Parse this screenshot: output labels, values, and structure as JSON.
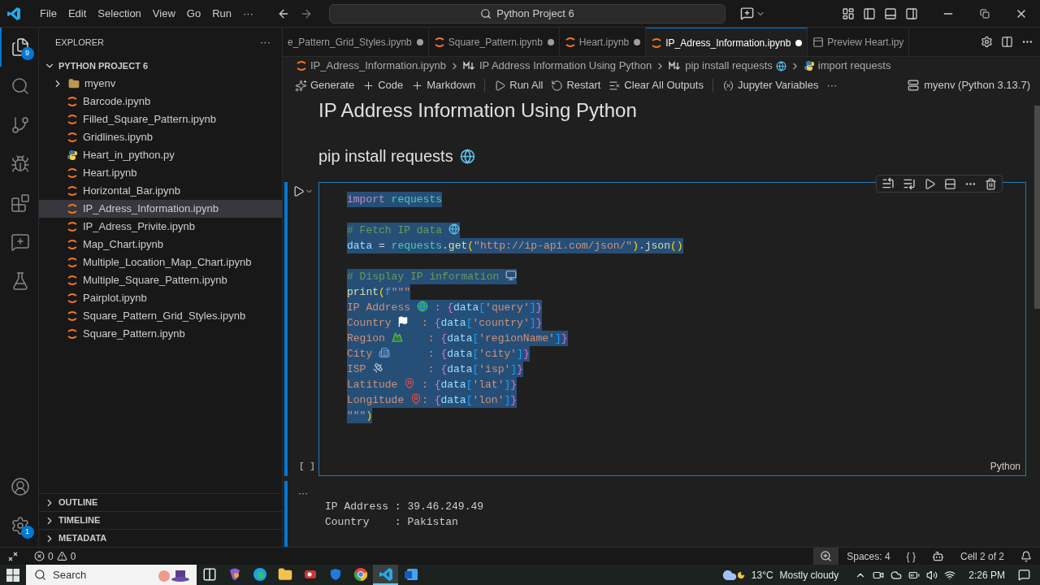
{
  "titlebar": {
    "menu": [
      "File",
      "Edit",
      "Selection",
      "View",
      "Go",
      "Run",
      "···"
    ],
    "search": "Python Project 6"
  },
  "activity_bar": {
    "top": [
      {
        "kind": "explorer",
        "selected": true,
        "badge": "9"
      },
      {
        "kind": "search",
        "selected": false
      },
      {
        "kind": "source-control",
        "selected": false
      },
      {
        "kind": "debug",
        "selected": false
      },
      {
        "kind": "extensions",
        "selected": false
      },
      {
        "kind": "chat",
        "selected": false
      },
      {
        "kind": "testing",
        "selected": false
      }
    ],
    "bottom": [
      {
        "kind": "account",
        "selected": false
      },
      {
        "kind": "settings",
        "selected": false,
        "badge": "1"
      }
    ]
  },
  "sidebar": {
    "title": "EXPLORER",
    "more": "···",
    "project": {
      "name": "PYTHON PROJECT 6",
      "expanded": true
    },
    "files": [
      {
        "name": "myenv",
        "kind": "folder",
        "expanded": false,
        "selected": false
      },
      {
        "name": "Barcode.ipynb",
        "kind": "notebook",
        "selected": false
      },
      {
        "name": "Filled_Square_Pattern.ipynb",
        "kind": "notebook",
        "selected": false
      },
      {
        "name": "Gridlines.ipynb",
        "kind": "notebook",
        "selected": false
      },
      {
        "name": "Heart_in_python.py",
        "kind": "python",
        "selected": false
      },
      {
        "name": "Heart.ipynb",
        "kind": "notebook",
        "selected": false
      },
      {
        "name": "Horizontal_Bar.ipynb",
        "kind": "notebook",
        "selected": false
      },
      {
        "name": "IP_Adress_Information.ipynb",
        "kind": "notebook",
        "selected": true
      },
      {
        "name": "IP_Adress_Privite.ipynb",
        "kind": "notebook",
        "selected": false
      },
      {
        "name": "Map_Chart.ipynb",
        "kind": "notebook",
        "selected": false
      },
      {
        "name": "Multiple_Location_Map_Chart.ipynb",
        "kind": "notebook",
        "selected": false
      },
      {
        "name": "Multiple_Square_Pattern.ipynb",
        "kind": "notebook",
        "selected": false
      },
      {
        "name": "Pairplot.ipynb",
        "kind": "notebook",
        "selected": false
      },
      {
        "name": "Square_Pattern_Grid_Styles.ipynb",
        "kind": "notebook",
        "selected": false
      },
      {
        "name": "Square_Pattern.ipynb",
        "kind": "notebook",
        "selected": false
      }
    ],
    "sections": [
      {
        "name": "OUTLINE",
        "expanded": false
      },
      {
        "name": "TIMELINE",
        "expanded": false
      },
      {
        "name": "METADATA",
        "expanded": false
      }
    ]
  },
  "tabs": [
    {
      "label": "e_Pattern_Grid_Styles.ipynb",
      "kind": "plain",
      "modified": true,
      "selected": false
    },
    {
      "label": "Square_Pattern.ipynb",
      "kind": "notebook",
      "modified": true,
      "selected": false
    },
    {
      "label": "Heart.ipynb",
      "kind": "notebook",
      "modified": true,
      "selected": false
    },
    {
      "label": "IP_Adress_Information.ipynb",
      "kind": "notebook",
      "modified": true,
      "selected": true
    },
    {
      "label": "Preview Heart.ipy",
      "kind": "preview",
      "modified": false,
      "selected": false
    }
  ],
  "breadcrumbs": [
    {
      "label": "IP_Adress_Information.ipynb",
      "kind": "notebook"
    },
    {
      "label": "IP Address Information Using Python",
      "kind": "markdown"
    },
    {
      "label": "pip install requests",
      "kind": "markdown-globe"
    },
    {
      "label": "import requests",
      "kind": "python"
    }
  ],
  "toolbar": [
    {
      "label": "Generate",
      "kind": "generate"
    },
    {
      "label": "Code",
      "kind": "add"
    },
    {
      "label": "Markdown",
      "kind": "add"
    },
    {
      "kind": "separator"
    },
    {
      "label": "Run All",
      "kind": "run"
    },
    {
      "label": "Restart",
      "kind": "restart"
    },
    {
      "label": "Clear All Outputs",
      "kind": "clear"
    },
    {
      "kind": "separator"
    },
    {
      "label": "Jupyter Variables",
      "kind": "variables"
    },
    {
      "label": "···",
      "kind": "more"
    }
  ],
  "kernel": "myenv (Python 3.13.7)",
  "notebook": {
    "heading": "IP Address Information Using Python",
    "subheading": "pip install requests",
    "cell": {
      "selected": true,
      "language": "Python",
      "execution": "[ ]",
      "lines": [
        {
          "blank_before": false,
          "tokens": [
            {
              "t": "import",
              "kind": "keyword"
            },
            {
              "t": " requests",
              "kind": "module"
            }
          ]
        },
        {
          "blank_before": true,
          "tokens": [
            {
              "t": "# Fetch IP data ",
              "kind": "comment"
            },
            {
              "kind": "globe"
            }
          ]
        },
        {
          "blank_before": false,
          "tokens": [
            {
              "t": "data",
              "kind": "variable"
            },
            {
              "t": " = ",
              "kind": "plain"
            },
            {
              "t": "requests",
              "kind": "module"
            },
            {
              "t": ".",
              "kind": "plain"
            },
            {
              "t": "get",
              "kind": "function"
            },
            {
              "t": "(",
              "kind": "paren"
            },
            {
              "t": "\"http://ip-api.com/json/\"",
              "kind": "string"
            },
            {
              "t": ")",
              "kind": "paren"
            },
            {
              "t": ".",
              "kind": "plain"
            },
            {
              "t": "json",
              "kind": "function"
            },
            {
              "t": "()",
              "kind": "paren"
            }
          ]
        },
        {
          "blank_before": true,
          "tokens": [
            {
              "t": "# Display IP information ",
              "kind": "comment"
            },
            {
              "kind": "monitor"
            }
          ]
        },
        {
          "blank_before": false,
          "tokens": [
            {
              "t": "print",
              "kind": "function"
            },
            {
              "t": "(",
              "kind": "paren"
            },
            {
              "t": "f",
              "kind": "prefix"
            },
            {
              "t": "\"\"\"",
              "kind": "string"
            }
          ]
        },
        {
          "blank_before": false,
          "tokens": [
            {
              "t": "IP Address ",
              "kind": "string"
            },
            {
              "kind": "earth"
            },
            {
              "t": " : ",
              "kind": "string"
            },
            {
              "t": "{",
              "kind": "brace"
            },
            {
              "t": "data",
              "kind": "variable"
            },
            {
              "t": "[",
              "kind": "bracket"
            },
            {
              "t": "'query'",
              "kind": "string"
            },
            {
              "t": "]",
              "kind": "bracket"
            },
            {
              "t": "}",
              "kind": "brace"
            }
          ]
        },
        {
          "blank_before": false,
          "tokens": [
            {
              "t": "Country ",
              "kind": "string"
            },
            {
              "kind": "flag"
            },
            {
              "t": "  : ",
              "kind": "string"
            },
            {
              "t": "{",
              "kind": "brace"
            },
            {
              "t": "data",
              "kind": "variable"
            },
            {
              "t": "[",
              "kind": "bracket"
            },
            {
              "t": "'country'",
              "kind": "string"
            },
            {
              "t": "]",
              "kind": "bracket"
            },
            {
              "t": "}",
              "kind": "brace"
            }
          ]
        },
        {
          "blank_before": false,
          "tokens": [
            {
              "t": "Region ",
              "kind": "string"
            },
            {
              "kind": "mountain"
            },
            {
              "t": "    : ",
              "kind": "string"
            },
            {
              "t": "{",
              "kind": "brace"
            },
            {
              "t": "data",
              "kind": "variable"
            },
            {
              "t": "[",
              "kind": "bracket"
            },
            {
              "t": "'regionName'",
              "kind": "string"
            },
            {
              "t": "]",
              "kind": "bracket"
            },
            {
              "t": "}",
              "kind": "brace"
            }
          ]
        },
        {
          "blank_before": false,
          "tokens": [
            {
              "t": "City ",
              "kind": "string"
            },
            {
              "kind": "city"
            },
            {
              "t": "      : ",
              "kind": "string"
            },
            {
              "t": "{",
              "kind": "brace"
            },
            {
              "t": "data",
              "kind": "variable"
            },
            {
              "t": "[",
              "kind": "bracket"
            },
            {
              "t": "'city'",
              "kind": "string"
            },
            {
              "t": "]",
              "kind": "bracket"
            },
            {
              "t": "}",
              "kind": "brace"
            }
          ]
        },
        {
          "blank_before": false,
          "tokens": [
            {
              "t": "ISP ",
              "kind": "string"
            },
            {
              "kind": "satellite"
            },
            {
              "t": "       : ",
              "kind": "string"
            },
            {
              "t": "{",
              "kind": "brace"
            },
            {
              "t": "data",
              "kind": "variable"
            },
            {
              "t": "[",
              "kind": "bracket"
            },
            {
              "t": "'isp'",
              "kind": "string"
            },
            {
              "t": "]",
              "kind": "bracket"
            },
            {
              "t": "}",
              "kind": "brace"
            }
          ]
        },
        {
          "blank_before": false,
          "tokens": [
            {
              "t": "Latitude ",
              "kind": "string"
            },
            {
              "kind": "pin"
            },
            {
              "t": " : ",
              "kind": "string"
            },
            {
              "t": "{",
              "kind": "brace"
            },
            {
              "t": "data",
              "kind": "variable"
            },
            {
              "t": "[",
              "kind": "bracket"
            },
            {
              "t": "'lat'",
              "kind": "string"
            },
            {
              "t": "]",
              "kind": "bracket"
            },
            {
              "t": "}",
              "kind": "brace"
            }
          ]
        },
        {
          "blank_before": false,
          "tokens": [
            {
              "t": "Longitude ",
              "kind": "string"
            },
            {
              "kind": "pin"
            },
            {
              "t": ": ",
              "kind": "string"
            },
            {
              "t": "{",
              "kind": "brace"
            },
            {
              "t": "data",
              "kind": "variable"
            },
            {
              "t": "[",
              "kind": "bracket"
            },
            {
              "t": "'lon'",
              "kind": "string"
            },
            {
              "t": "]",
              "kind": "bracket"
            },
            {
              "t": "}",
              "kind": "brace"
            }
          ]
        },
        {
          "blank_before": false,
          "tokens": [
            {
              "t": "\"\"\"",
              "kind": "string"
            },
            {
              "t": ")",
              "kind": "paren"
            }
          ]
        }
      ]
    },
    "output_more": "···",
    "output": [
      "IP Address : 39.46.249.49",
      "Country    : Pakistan"
    ]
  },
  "status_bar": {
    "errors": "0",
    "warnings": "0",
    "right": [
      {
        "kind": "zoom"
      },
      {
        "label": "Spaces: 4",
        "kind": "text"
      },
      {
        "label": "{ }",
        "kind": "text"
      },
      {
        "kind": "copilot"
      },
      {
        "label": "Cell 2 of 2",
        "kind": "text"
      },
      {
        "kind": "bell"
      }
    ]
  },
  "taskbar": {
    "search": "Search",
    "apps": [
      {
        "kind": "taskview",
        "selected": false
      },
      {
        "kind": "copilot",
        "selected": false
      },
      {
        "kind": "edge",
        "selected": false
      },
      {
        "kind": "files",
        "selected": false
      },
      {
        "kind": "recorder",
        "selected": false
      },
      {
        "kind": "defender",
        "selected": false
      },
      {
        "kind": "chrome",
        "selected": false
      },
      {
        "kind": "vscode",
        "selected": true
      },
      {
        "kind": "word",
        "selected": false
      }
    ],
    "temperature": "13°C",
    "weather": "Mostly cloudy",
    "time": "2:26 PM"
  }
}
